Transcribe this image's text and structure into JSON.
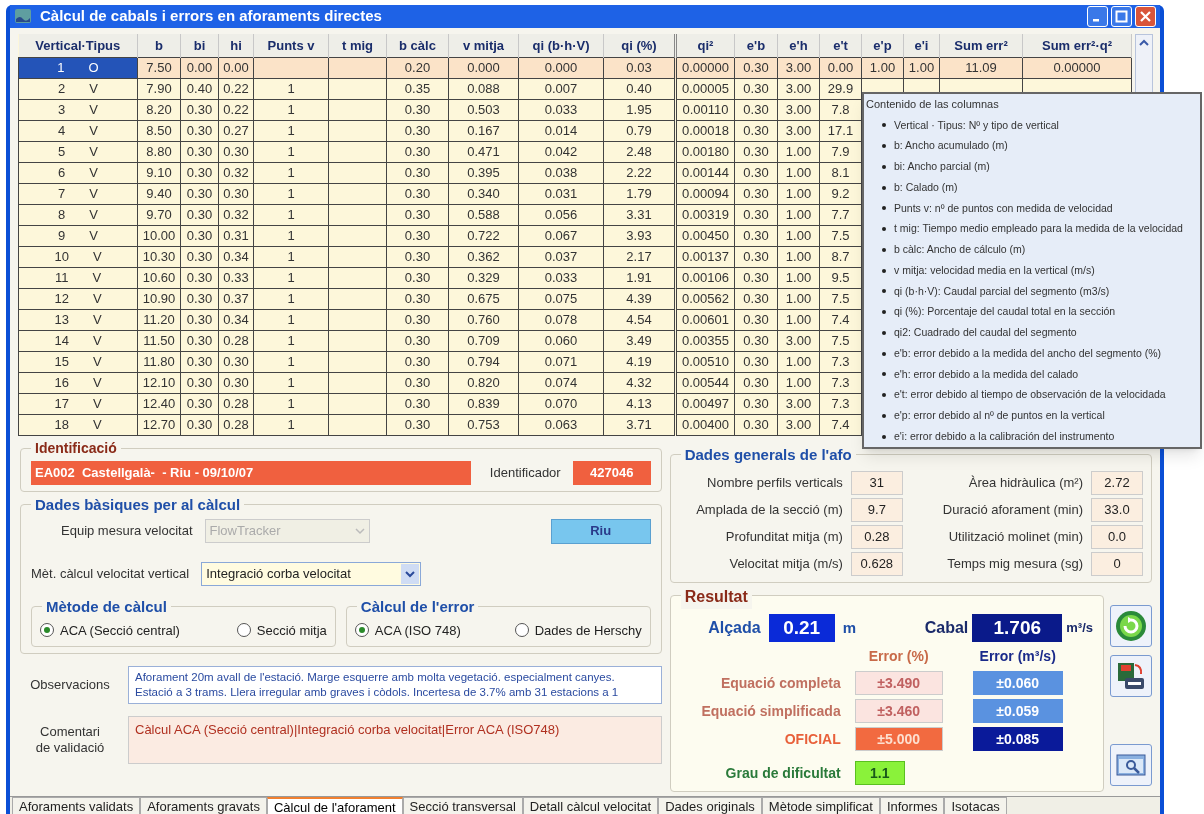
{
  "window": {
    "title": "Càlcul de cabals i errors en aforaments directes"
  },
  "table": {
    "vertical_header": "Vertical·Tipus",
    "columns": [
      "b",
      "bi",
      "hi",
      "Punts v",
      "t mig",
      "b càlc",
      "v mitja",
      "qi (b·h·V)",
      "qi (%)",
      "qi²",
      "e'b",
      "e'h",
      "e't",
      "e'p",
      "e'i",
      "Sum err²",
      "Sum err²·q²"
    ],
    "rows": [
      {
        "selected": true,
        "vertical": "1",
        "tipus": "O",
        "cells": [
          "7.50",
          "0.00",
          "0.00",
          null,
          null,
          "0.20",
          "0.000",
          "0.000",
          "0.03",
          "0.00000",
          "0.30",
          "3.00",
          "0.00",
          "1.00",
          "1.00",
          "11.09",
          "0.00000"
        ]
      },
      {
        "selected": false,
        "vertical": "2",
        "tipus": "V",
        "cells": [
          "7.90",
          "0.40",
          "0.22",
          "1",
          null,
          "0.35",
          "0.088",
          "0.007",
          "0.40",
          "0.00005",
          "0.30",
          "3.00",
          "29.9"
        ]
      },
      {
        "selected": false,
        "vertical": "3",
        "tipus": "V",
        "cells": [
          "8.20",
          "0.30",
          "0.22",
          "1",
          null,
          "0.30",
          "0.503",
          "0.033",
          "1.95",
          "0.00110",
          "0.30",
          "3.00",
          "7.8"
        ]
      },
      {
        "selected": false,
        "vertical": "4",
        "tipus": "V",
        "cells": [
          "8.50",
          "0.30",
          "0.27",
          "1",
          null,
          "0.30",
          "0.167",
          "0.014",
          "0.79",
          "0.00018",
          "0.30",
          "3.00",
          "17.1"
        ]
      },
      {
        "selected": false,
        "vertical": "5",
        "tipus": "V",
        "cells": [
          "8.80",
          "0.30",
          "0.30",
          "1",
          null,
          "0.30",
          "0.471",
          "0.042",
          "2.48",
          "0.00180",
          "0.30",
          "1.00",
          "7.9"
        ]
      },
      {
        "selected": false,
        "vertical": "6",
        "tipus": "V",
        "cells": [
          "9.10",
          "0.30",
          "0.32",
          "1",
          null,
          "0.30",
          "0.395",
          "0.038",
          "2.22",
          "0.00144",
          "0.30",
          "1.00",
          "8.1"
        ]
      },
      {
        "selected": false,
        "vertical": "7",
        "tipus": "V",
        "cells": [
          "9.40",
          "0.30",
          "0.30",
          "1",
          null,
          "0.30",
          "0.340",
          "0.031",
          "1.79",
          "0.00094",
          "0.30",
          "1.00",
          "9.2"
        ]
      },
      {
        "selected": false,
        "vertical": "8",
        "tipus": "V",
        "cells": [
          "9.70",
          "0.30",
          "0.32",
          "1",
          null,
          "0.30",
          "0.588",
          "0.056",
          "3.31",
          "0.00319",
          "0.30",
          "1.00",
          "7.7"
        ]
      },
      {
        "selected": false,
        "vertical": "9",
        "tipus": "V",
        "cells": [
          "10.00",
          "0.30",
          "0.31",
          "1",
          null,
          "0.30",
          "0.722",
          "0.067",
          "3.93",
          "0.00450",
          "0.30",
          "1.00",
          "7.5"
        ]
      },
      {
        "selected": false,
        "vertical": "10",
        "tipus": "V",
        "cells": [
          "10.30",
          "0.30",
          "0.34",
          "1",
          null,
          "0.30",
          "0.362",
          "0.037",
          "2.17",
          "0.00137",
          "0.30",
          "1.00",
          "8.7"
        ]
      },
      {
        "selected": false,
        "vertical": "11",
        "tipus": "V",
        "cells": [
          "10.60",
          "0.30",
          "0.33",
          "1",
          null,
          "0.30",
          "0.329",
          "0.033",
          "1.91",
          "0.00106",
          "0.30",
          "1.00",
          "9.5"
        ]
      },
      {
        "selected": false,
        "vertical": "12",
        "tipus": "V",
        "cells": [
          "10.90",
          "0.30",
          "0.37",
          "1",
          null,
          "0.30",
          "0.675",
          "0.075",
          "4.39",
          "0.00562",
          "0.30",
          "1.00",
          "7.5"
        ]
      },
      {
        "selected": false,
        "vertical": "13",
        "tipus": "V",
        "cells": [
          "11.20",
          "0.30",
          "0.34",
          "1",
          null,
          "0.30",
          "0.760",
          "0.078",
          "4.54",
          "0.00601",
          "0.30",
          "1.00",
          "7.4"
        ]
      },
      {
        "selected": false,
        "vertical": "14",
        "tipus": "V",
        "cells": [
          "11.50",
          "0.30",
          "0.28",
          "1",
          null,
          "0.30",
          "0.709",
          "0.060",
          "3.49",
          "0.00355",
          "0.30",
          "3.00",
          "7.5"
        ]
      },
      {
        "selected": false,
        "vertical": "15",
        "tipus": "V",
        "cells": [
          "11.80",
          "0.30",
          "0.30",
          "1",
          null,
          "0.30",
          "0.794",
          "0.071",
          "4.19",
          "0.00510",
          "0.30",
          "1.00",
          "7.3"
        ]
      },
      {
        "selected": false,
        "vertical": "16",
        "tipus": "V",
        "cells": [
          "12.10",
          "0.30",
          "0.30",
          "1",
          null,
          "0.30",
          "0.820",
          "0.074",
          "4.32",
          "0.00544",
          "0.30",
          "1.00",
          "7.3"
        ]
      },
      {
        "selected": false,
        "vertical": "17",
        "tipus": "V",
        "cells": [
          "12.40",
          "0.30",
          "0.28",
          "1",
          null,
          "0.30",
          "0.839",
          "0.070",
          "4.13",
          "0.00497",
          "0.30",
          "3.00",
          "7.3"
        ]
      },
      {
        "selected": false,
        "vertical": "18",
        "tipus": "V",
        "cells": [
          "12.70",
          "0.30",
          "0.28",
          "1",
          null,
          "0.30",
          "0.753",
          "0.063",
          "3.71",
          "0.00400",
          "0.30",
          "3.00",
          "7.4"
        ]
      }
    ]
  },
  "tooltip": {
    "title": "Contenido de las columnas",
    "items": [
      "Vertical · Tipus: Nº y tipo de vertical",
      "b: Ancho acumulado (m)",
      "bi: Ancho parcial (m)",
      "b: Calado (m)",
      "Punts v: nº de puntos con medida de velocidad",
      "t mig: Tiempo medio empleado para la medida de la velocidad",
      "b càlc: Ancho de cálculo (m)",
      "v mitja: velocidad media en la vertical (m/s)",
      "qi (b·h·V): Caudal parcial del segmento (m3/s)",
      "qi (%): Porcentaje del caudal total en la sección",
      "qi2: Cuadrado del caudal del segmento",
      "e'b: error debido a la medida del ancho del segmento (%)",
      "e'h: error debido a la medida del calado",
      "e't: error debido al tiempo de observación de la velocidada",
      "e'p: error debido al nº de puntos en la vertical",
      "e'i: error debido a la calibración del instrumento"
    ]
  },
  "identificacio": {
    "title": "Identificació",
    "value": "EA002  Castellgalà-  - Riu - 09/10/07",
    "id_label": "Identificador",
    "id_value": "427046"
  },
  "dades_basiques": {
    "title": "Dades bàsiques per al càlcul",
    "equip_label": "Equip mesura velocitat",
    "equip_value": "FlowTracker",
    "equip_disabled": true,
    "button": "Riu",
    "metode_label": "Mèt. càlcul velocitat vertical",
    "metode_value": "Integració corba velocitat"
  },
  "radio_groups": [
    {
      "title": "Mètode de càlcul",
      "options": [
        {
          "label": "ACA (Secció central)",
          "selected": true
        },
        {
          "label": "Secció mitja",
          "selected": false
        }
      ]
    },
    {
      "title": "Càlcul de l'error",
      "options": [
        {
          "label": "ACA (ISO 748)",
          "selected": true
        },
        {
          "label": "Dades de Herschy",
          "selected": false
        }
      ]
    }
  ],
  "observacions": {
    "label": "Observacions",
    "lines": [
      "Aforament 20m avall de l'estació. Marge esquerre amb molta vegetació. especialment canyes.",
      "Estació a 3 trams. Llera irregular amb graves i còdols. Incertesa de 3.7% amb 31 estacions a 1"
    ]
  },
  "comentari": {
    "label": "Comentari de validació",
    "value": "Càlcul ACA (Secció central)|Integració corba velocitat|Error ACA (ISO748)"
  },
  "dades_generals": {
    "title": "Dades generals de l'afo",
    "left": [
      {
        "label": "Nombre perfils verticals",
        "value": "31"
      },
      {
        "label": "Amplada de la secció (m)",
        "value": "9.7"
      },
      {
        "label": "Profunditat mitja (m)",
        "value": "0.28"
      },
      {
        "label": "Velocitat mitja (m/s)",
        "value": "0.628"
      }
    ],
    "right": [
      {
        "label": "Àrea hidràulica (m²)",
        "value": "2.72"
      },
      {
        "label": "Duració aforament (min)",
        "value": "33.0"
      },
      {
        "label": "Utilització molinet (min)",
        "value": "0.0"
      },
      {
        "label": "Temps mig mesura (sg)",
        "value": "0"
      }
    ]
  },
  "resultat": {
    "title": "Resultat",
    "alcada_label": "Alçada",
    "alcada_value": "0.21",
    "alcada_unit": "m",
    "cabal_label": "Cabal",
    "cabal_value": "1.706",
    "cabal_unit": "m³/s",
    "error_pct_header": "Error (%)",
    "error_abs_header": "Error (m³/s)",
    "rows": [
      {
        "kind": "normal",
        "label": "Equació completa",
        "pct": "±3.490",
        "abs": "±0.060"
      },
      {
        "kind": "normal",
        "label": "Equació simplificada",
        "pct": "±3.460",
        "abs": "±0.059"
      },
      {
        "kind": "official",
        "label": "OFICIAL",
        "pct": "±5.000",
        "abs": "±0.085"
      }
    ],
    "grau_label": "Grau de dificultat",
    "grau_value": "1.1"
  },
  "tabs": [
    {
      "label": "Aforaments validats",
      "selected": false
    },
    {
      "label": "Aforaments gravats",
      "selected": false
    },
    {
      "label": "Càlcul de l'aforament",
      "selected": true
    },
    {
      "label": "Secció transversal",
      "selected": false
    },
    {
      "label": "Detall càlcul velocitat",
      "selected": false
    },
    {
      "label": "Dades originals",
      "selected": false
    },
    {
      "label": "Mètode simplificat",
      "selected": false
    },
    {
      "label": "Informes",
      "selected": false
    },
    {
      "label": "Isotacas",
      "selected": false
    }
  ]
}
